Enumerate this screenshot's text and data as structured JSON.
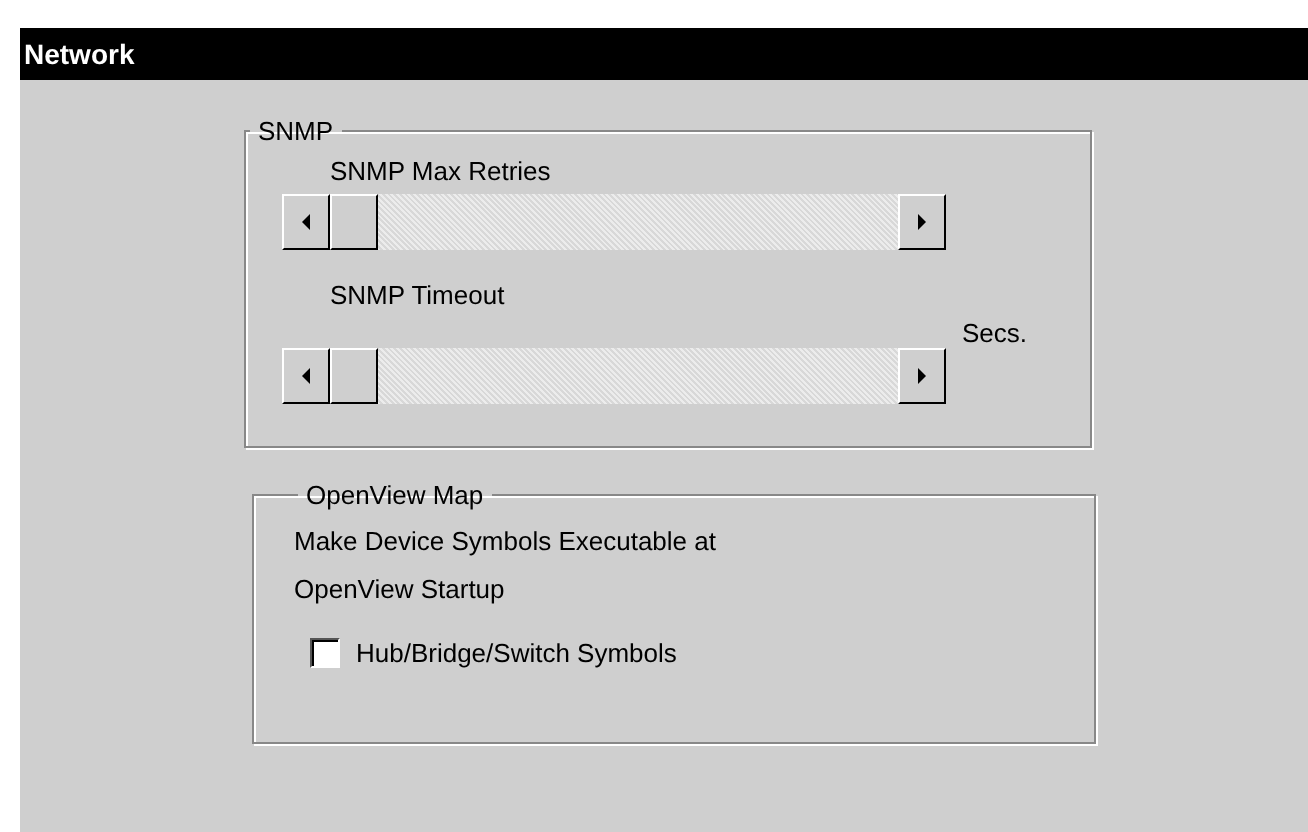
{
  "window": {
    "title": "Network"
  },
  "snmp": {
    "title": "SNMP",
    "sliders": [
      {
        "label": "SNMP Max Retries",
        "level": 0
      },
      {
        "label": "SNMP Timeout",
        "level": 0,
        "unit": "Secs."
      }
    ]
  },
  "openview": {
    "title": "OpenView Map",
    "description": "Make Device Symbols Executable at OpenView Startup",
    "checkboxes": [
      {
        "label": "Hub/Bridge/Switch Symbols",
        "checked": false
      }
    ]
  }
}
